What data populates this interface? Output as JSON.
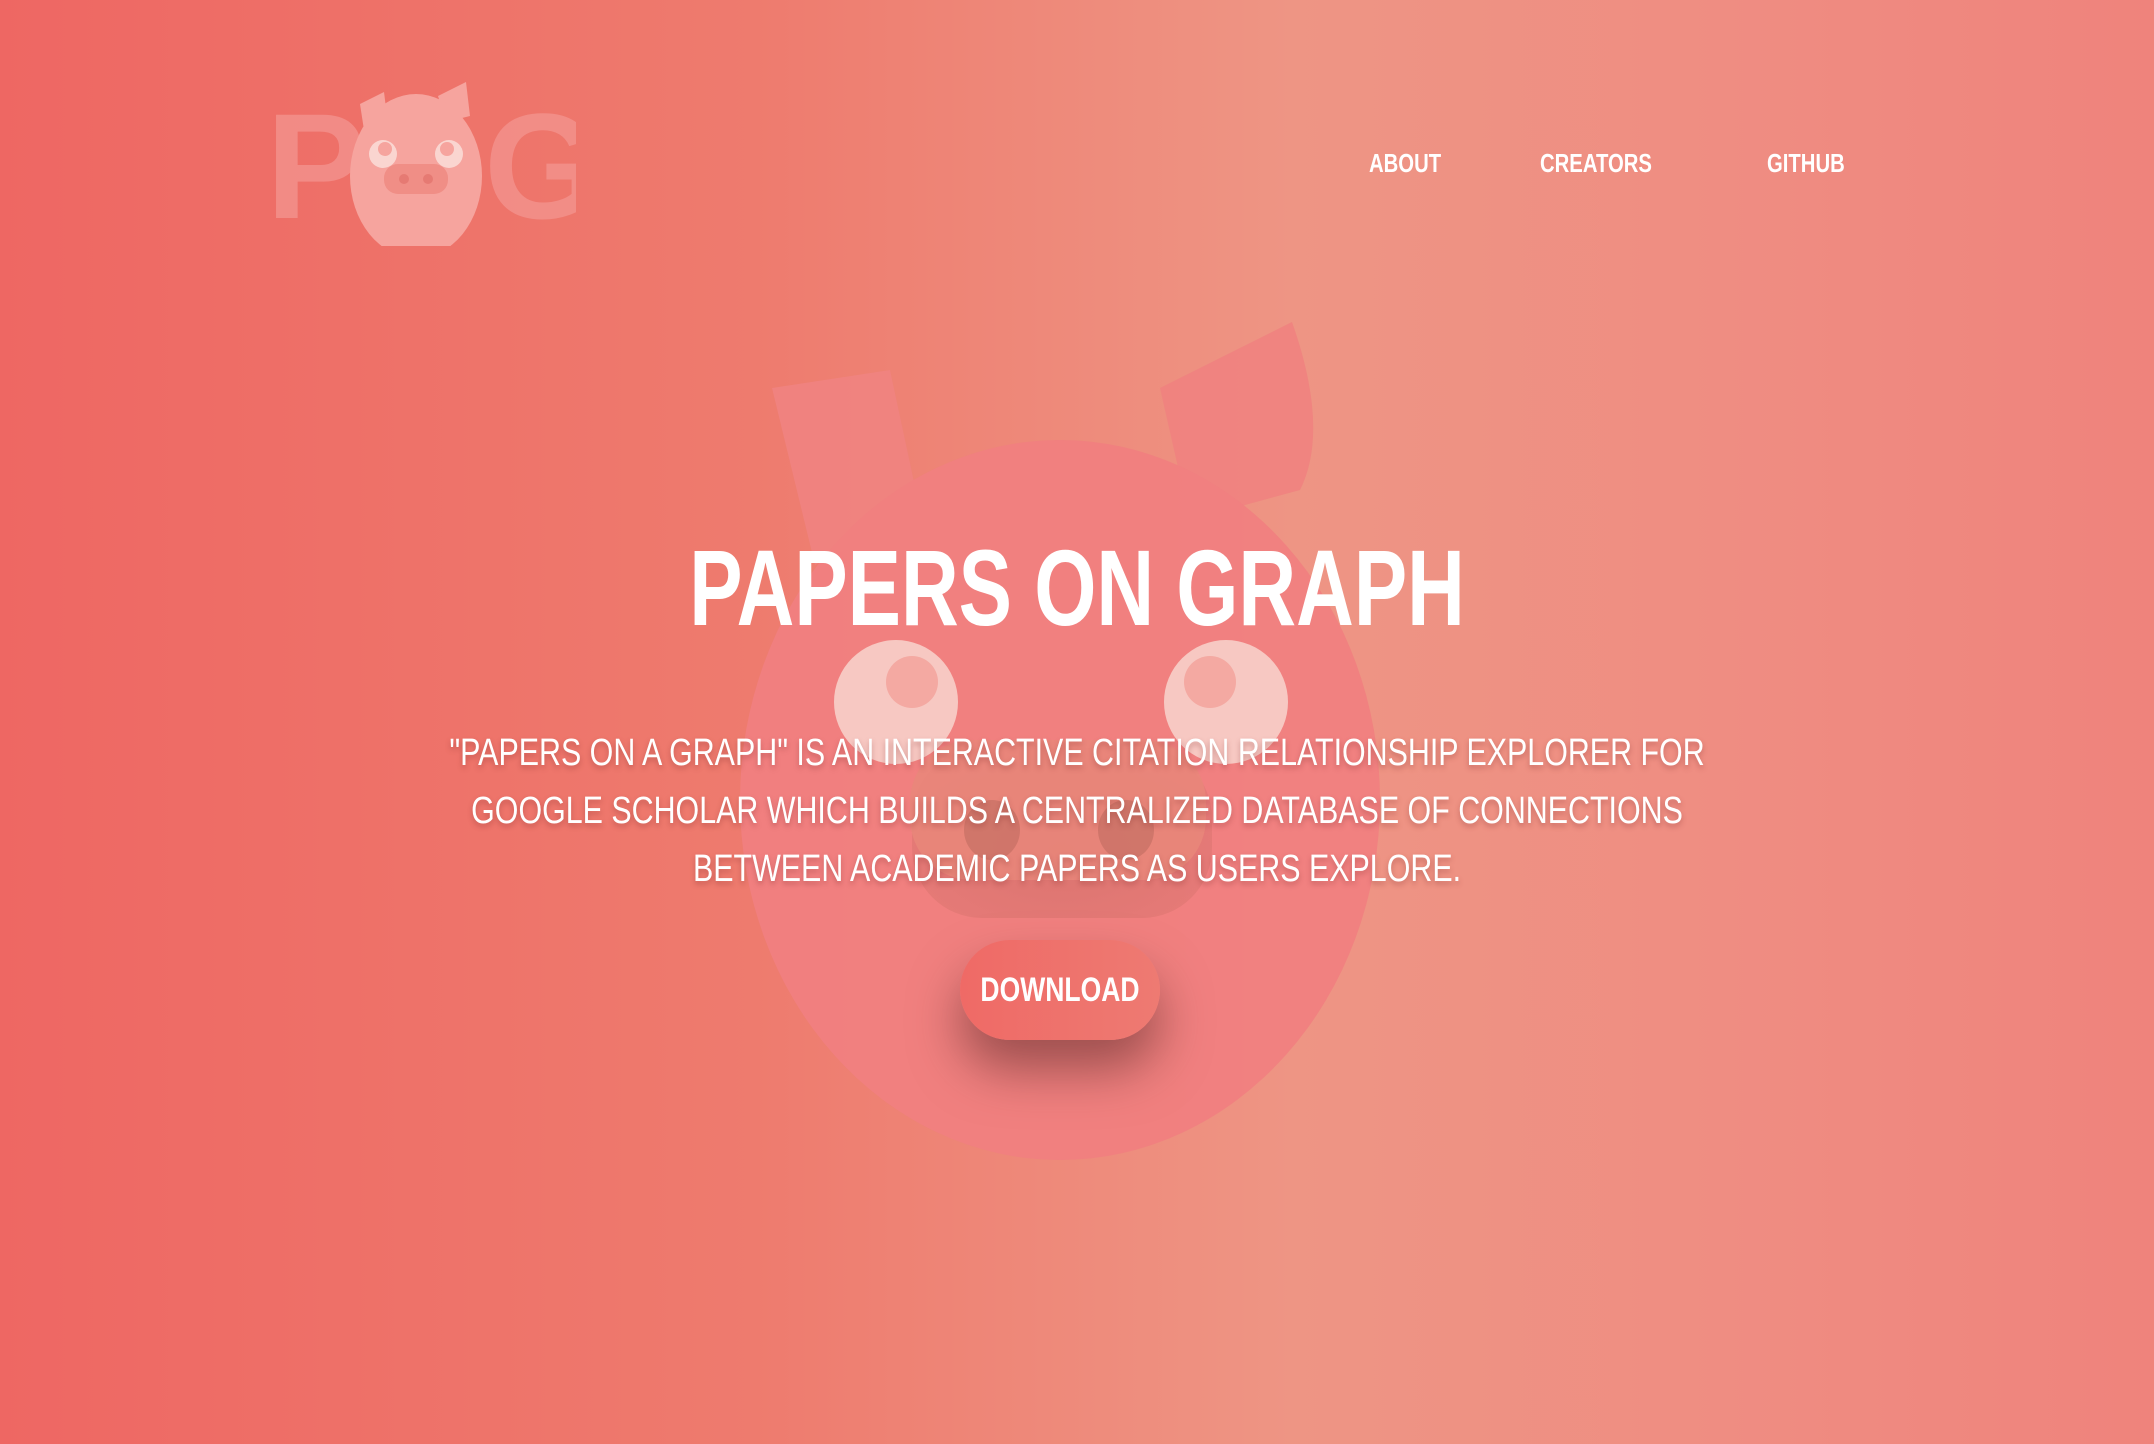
{
  "header": {
    "logo_text": "POG",
    "nav": {
      "about": "About",
      "creators": "Creators",
      "github": "Github"
    }
  },
  "hero": {
    "title": "Papers on Graph",
    "description": "\"Papers on a Graph\" is an interactive citation relationship explorer for Google Scholar which builds a centralized database of connections between academic papers as users explore.",
    "download_label": "Download"
  },
  "icons": {
    "logo_mascot": "pig-face-icon",
    "background_mascot": "pig-face-icon"
  },
  "colors": {
    "gradient_left": "#ee6763",
    "gradient_mid": "#ee9584",
    "gradient_right": "#ef837c",
    "pig_fill": "#f08080",
    "eye_white": "#f7c6bf",
    "text": "#ffffff"
  }
}
